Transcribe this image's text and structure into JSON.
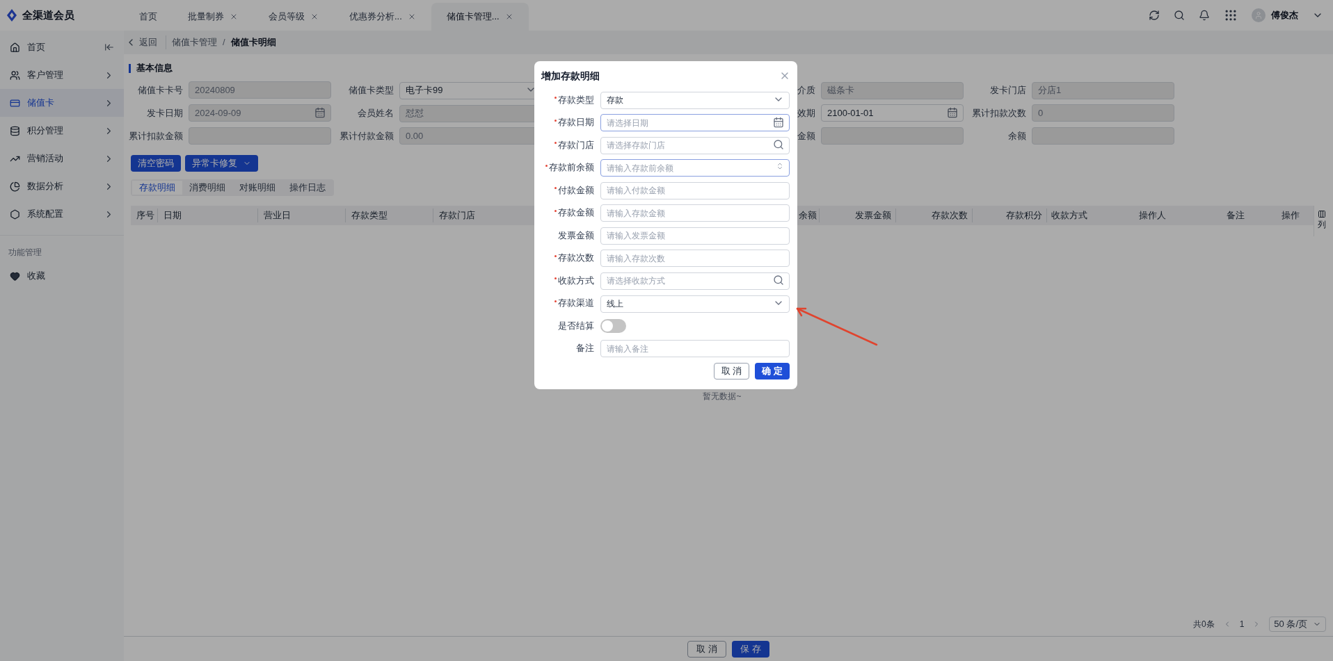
{
  "app": {
    "name": "全渠道会员"
  },
  "nav_tabs": [
    {
      "label": "首页",
      "closable": false,
      "selected": false
    },
    {
      "label": "批量制券",
      "closable": true,
      "selected": false
    },
    {
      "label": "会员等级",
      "closable": true,
      "selected": false
    },
    {
      "label": "优惠券分析...",
      "closable": true,
      "selected": false
    },
    {
      "label": "储值卡管理...",
      "closable": true,
      "selected": true
    }
  ],
  "user": {
    "name": "傅俊杰"
  },
  "sidebar": {
    "items": [
      {
        "label": "首页",
        "selected": false
      },
      {
        "label": "客户管理",
        "selected": false
      },
      {
        "label": "储值卡",
        "selected": true
      },
      {
        "label": "积分管理",
        "selected": false
      },
      {
        "label": "营销活动",
        "selected": false
      },
      {
        "label": "数据分析",
        "selected": false
      },
      {
        "label": "系统配置",
        "selected": false
      }
    ],
    "section_title": "功能管理",
    "favorites": "收藏"
  },
  "breadcrumb": {
    "back": "返回",
    "path": [
      "储值卡管理",
      "储值卡明细"
    ],
    "separator": "/"
  },
  "basic_info": {
    "title": "基本信息",
    "rows": [
      [
        {
          "label": "储值卡卡号",
          "value": "20240809",
          "kind": "text",
          "disabled": true
        },
        {
          "label": "储值卡类型",
          "value": "电子卡99",
          "kind": "select",
          "disabled": false
        },
        {
          "label": "介质",
          "value": "磁条卡",
          "kind": "text",
          "disabled": true
        },
        {
          "label": "发卡门店",
          "value": "分店1",
          "kind": "text",
          "disabled": true
        }
      ],
      [
        {
          "label": "发卡日期",
          "value": "2024-09-09",
          "kind": "date",
          "disabled": true
        },
        {
          "label": "会员姓名",
          "value": "怼怼",
          "kind": "text",
          "disabled": true
        },
        {
          "label": "效期",
          "value": "2100-01-01",
          "kind": "date",
          "disabled": false
        },
        {
          "label": "累计扣款次数",
          "value": "0",
          "kind": "text",
          "disabled": true
        }
      ],
      [
        {
          "label": "累计扣款金额",
          "kind": "text",
          "disabled": true
        },
        {
          "label": "累计付款金额",
          "value": "0.00",
          "kind": "text",
          "disabled": true
        },
        {
          "label": "金额",
          "kind": "text",
          "disabled": true
        },
        {
          "label": "余额",
          "kind": "text",
          "disabled": true
        }
      ]
    ]
  },
  "actions": [
    {
      "label": "清空密码",
      "kind": "button"
    },
    {
      "label": "异常卡修复",
      "kind": "dropdown"
    }
  ],
  "detail_tabs": [
    {
      "label": "存款明细",
      "selected": true
    },
    {
      "label": "消费明细",
      "selected": false
    },
    {
      "label": "对账明细",
      "selected": false
    },
    {
      "label": "操作日志",
      "selected": false
    }
  ],
  "table": {
    "columns": [
      "序号",
      "日期",
      "营业日",
      "存款类型",
      "存款门店",
      "余额",
      "发票金额",
      "存款次数",
      "存款积分",
      "收款方式",
      "操作人",
      "备注",
      "操作"
    ],
    "empty_text": "暂无数据~",
    "column_settings": "列"
  },
  "pagination": {
    "total": "共0条",
    "page": "1",
    "page_size": "50 条/页"
  },
  "footer_buttons": [
    {
      "label": "取 消",
      "kind": "default"
    },
    {
      "label": "保 存",
      "kind": "primary"
    }
  ],
  "dialog": {
    "title": "增加存款明细",
    "fields": [
      {
        "label": "存款类型",
        "required": true,
        "kind": "select",
        "value": "存款",
        "focused": false
      },
      {
        "label": "存款日期",
        "required": true,
        "kind": "date",
        "placeholder": "请选择日期",
        "focused": true
      },
      {
        "label": "存款门店",
        "required": true,
        "kind": "search",
        "placeholder": "请选择存款门店",
        "focused": false
      },
      {
        "label": "存款前余额",
        "required": true,
        "kind": "number",
        "placeholder": "请输入存款前余额",
        "focused": true
      },
      {
        "label": "付款金额",
        "required": true,
        "kind": "text",
        "placeholder": "请输入付款金额",
        "focused": false
      },
      {
        "label": "存款金额",
        "required": true,
        "kind": "text",
        "placeholder": "请输入存款金额",
        "focused": false
      },
      {
        "label": "发票金额",
        "required": false,
        "kind": "text",
        "placeholder": "请输入发票金额",
        "focused": false
      },
      {
        "label": "存款次数",
        "required": true,
        "kind": "text",
        "placeholder": "请输入存款次数",
        "focused": false
      },
      {
        "label": "收款方式",
        "required": true,
        "kind": "search",
        "placeholder": "请选择收款方式",
        "focused": false
      },
      {
        "label": "存款渠道",
        "required": true,
        "kind": "select",
        "value": "线上",
        "focused": false
      },
      {
        "label": "是否结算",
        "required": false,
        "kind": "switch",
        "on": false
      },
      {
        "label": "备注",
        "required": false,
        "kind": "text",
        "placeholder": "请输入备注",
        "focused": false
      }
    ],
    "buttons": [
      {
        "label": "取 消",
        "kind": "default"
      },
      {
        "label": "确 定",
        "kind": "primary"
      }
    ]
  }
}
